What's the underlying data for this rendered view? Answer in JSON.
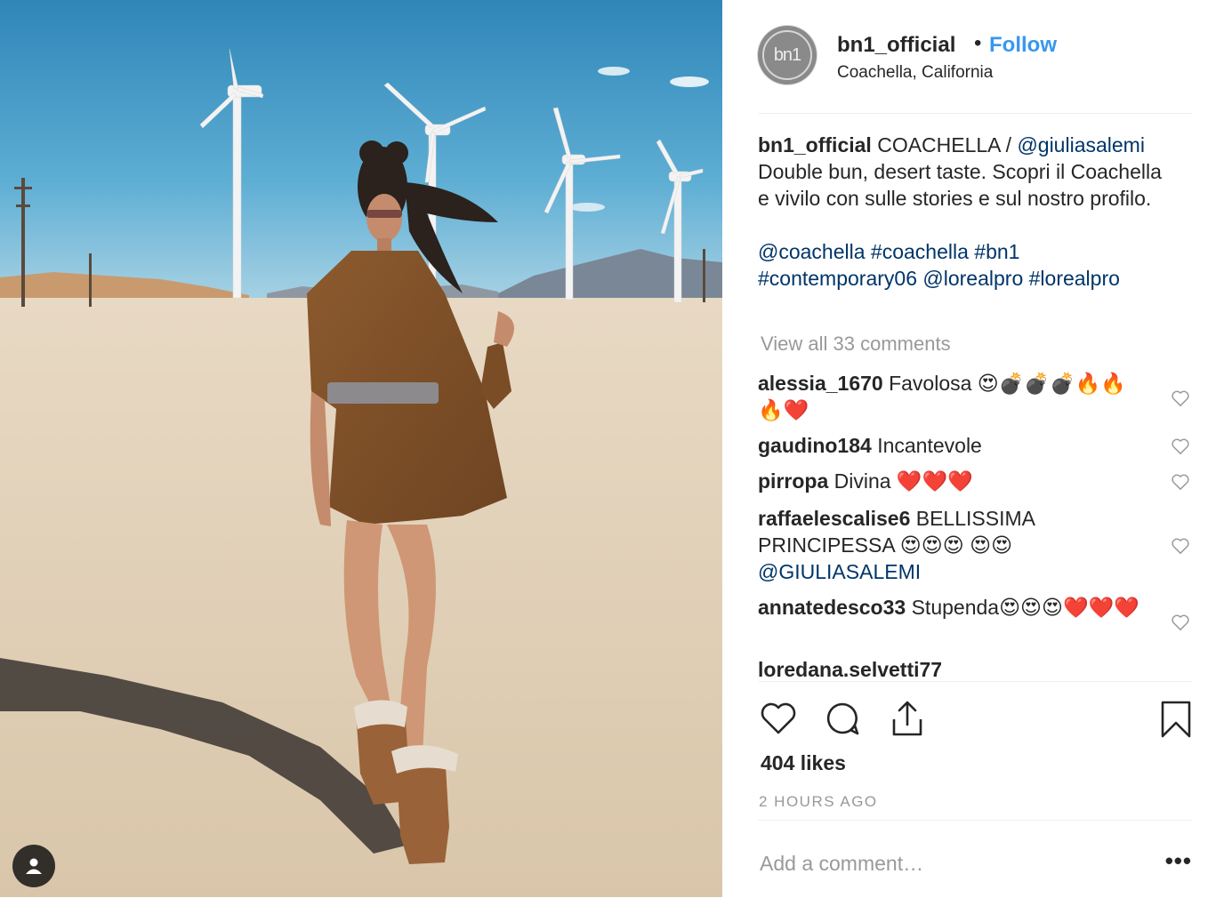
{
  "post": {
    "username": "bn1_official",
    "separator": "•",
    "follow_label": "Follow",
    "location": "Coachella, California",
    "avatar_text": "bn1",
    "caption": {
      "username": "bn1_official",
      "text_1": " COACHELLA / ",
      "mention_1": "@giuliasalemi",
      "text_2": " Double bun, desert taste. Scopri il Coachella e vivilo con sulle stories e sul nostro profilo.",
      "tags": [
        "@coachella",
        "#coachella",
        "#bn1",
        "#contemporary06",
        "@lorealpro",
        "#lorealpro"
      ]
    },
    "view_all_label": "View all 33 comments",
    "comments": [
      {
        "user": "alessia_1670",
        "text": " Favolosa 😍💣💣💣🔥🔥🔥❤️"
      },
      {
        "user": "gaudino184",
        "text": " Incantevole"
      },
      {
        "user": "pirropa",
        "text": " Divina ❤️❤️❤️"
      },
      {
        "user": "raffaelescalise6",
        "text": " BELLISSIMA PRINCIPESSA 😍😍😍 😍😍 ",
        "mention": "@GIULIASALEMI"
      },
      {
        "user": "annatedesco33",
        "text": " Stupenda😍😍😍❤️❤️❤️"
      },
      {
        "user": "loredana.selvetti77",
        "text": ""
      }
    ],
    "likes": "404 likes",
    "time_ago": "2 HOURS AGO",
    "add_comment_placeholder": "Add a comment…",
    "more_label": "•••"
  },
  "icons": {
    "like": "heart-icon",
    "comment": "comment-bubble-icon",
    "share": "share-upload-icon",
    "save": "bookmark-icon",
    "tag": "user-tag-icon"
  }
}
